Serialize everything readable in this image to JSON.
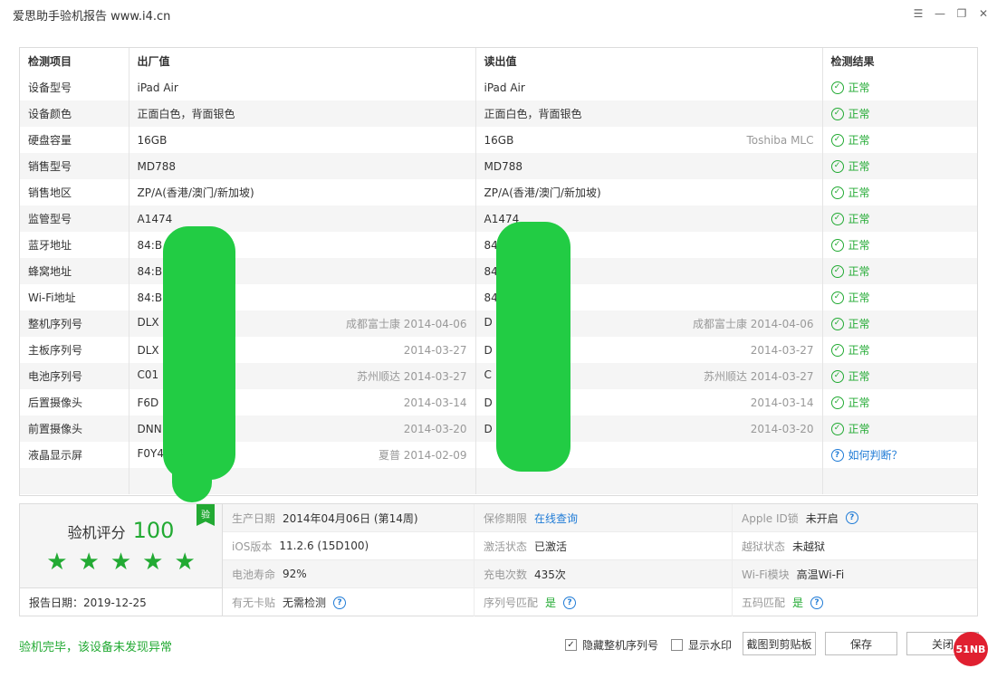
{
  "window": {
    "title": "爱思助手验机报告 www.i4.cn"
  },
  "table": {
    "headers": [
      "检测项目",
      "出厂值",
      "读出值",
      "检测结果"
    ],
    "rows": [
      {
        "item": "设备型号",
        "factory": "iPad Air",
        "factory_note": "",
        "read": "iPad Air",
        "read_note": "",
        "result": "正常",
        "result_kind": "ok"
      },
      {
        "item": "设备颜色",
        "factory": "正面白色，背面银色",
        "factory_note": "",
        "read": "正面白色，背面银色",
        "read_note": "",
        "result": "正常",
        "result_kind": "ok"
      },
      {
        "item": "硬盘容量",
        "factory": "16GB",
        "factory_note": "",
        "read": "16GB",
        "read_note": "Toshiba MLC",
        "result": "正常",
        "result_kind": "ok"
      },
      {
        "item": "销售型号",
        "factory": "MD788",
        "factory_note": "",
        "read": "MD788",
        "read_note": "",
        "result": "正常",
        "result_kind": "ok"
      },
      {
        "item": "销售地区",
        "factory": "ZP/A(香港/澳门/新加坡)",
        "factory_note": "",
        "read": "ZP/A(香港/澳门/新加坡)",
        "read_note": "",
        "result": "正常",
        "result_kind": "ok"
      },
      {
        "item": "监管型号",
        "factory": "A1474",
        "factory_note": "",
        "read": "A1474",
        "read_note": "",
        "result": "正常",
        "result_kind": "ok"
      },
      {
        "item": "蓝牙地址",
        "factory": "84:B",
        "factory_note": "",
        "read": "84:",
        "read_note": "",
        "result": "正常",
        "result_kind": "ok"
      },
      {
        "item": "蜂窝地址",
        "factory": "84:B",
        "factory_note": "",
        "read": "84:",
        "read_note": "",
        "result": "正常",
        "result_kind": "ok"
      },
      {
        "item": "Wi-Fi地址",
        "factory": "84:B",
        "factory_note": "",
        "read": "84",
        "read_note": "",
        "result": "正常",
        "result_kind": "ok"
      },
      {
        "item": "整机序列号",
        "factory": "DLX",
        "factory_note": "成都富士康 2014-04-06",
        "read": "D",
        "read_note": "成都富士康 2014-04-06",
        "result": "正常",
        "result_kind": "ok"
      },
      {
        "item": "主板序列号",
        "factory": "DLX",
        "factory_note": "2014-03-27",
        "read": "D",
        "read_note": "2014-03-27",
        "result": "正常",
        "result_kind": "ok"
      },
      {
        "item": "电池序列号",
        "factory": "C01",
        "factory_note": "苏州顺达 2014-03-27",
        "read": "C",
        "read_note": "苏州顺达 2014-03-27",
        "result": "正常",
        "result_kind": "ok"
      },
      {
        "item": "后置摄像头",
        "factory": "F6D",
        "factory_note": "2014-03-14",
        "read": "D",
        "read_note": "2014-03-14",
        "result": "正常",
        "result_kind": "ok"
      },
      {
        "item": "前置摄像头",
        "factory": "DNN",
        "factory_note": "2014-03-20",
        "read": "D",
        "read_note": "2014-03-20",
        "result": "正常",
        "result_kind": "ok"
      },
      {
        "item": "液晶显示屏",
        "factory": "F0Y4",
        "factory_note": "夏普 2014-02-09",
        "read": "",
        "read_note": "",
        "result": "如何判断？",
        "result_kind": "help"
      }
    ]
  },
  "score": {
    "label": "验机评分",
    "value": "100",
    "badge": "验",
    "stars": 5,
    "report_date": "报告日期：2019-12-25"
  },
  "info": [
    {
      "key": "生产日期",
      "value": "2014年04月06日 (第14周)",
      "kind": "text"
    },
    {
      "key": "保修期限",
      "value": "在线查询",
      "kind": "link"
    },
    {
      "key": "Apple ID锁",
      "value": "未开启",
      "kind": "text",
      "help": true
    },
    {
      "key": "iOS版本",
      "value": "11.2.6 (15D100)",
      "kind": "text"
    },
    {
      "key": "激活状态",
      "value": "已激活",
      "kind": "text"
    },
    {
      "key": "越狱状态",
      "value": "未越狱",
      "kind": "text"
    },
    {
      "key": "电池寿命",
      "value": "92%",
      "kind": "text"
    },
    {
      "key": "充电次数",
      "value": "435次",
      "kind": "text"
    },
    {
      "key": "Wi-Fi模块",
      "value": "高温Wi-Fi",
      "kind": "text"
    },
    {
      "key": "有无卡贴",
      "value": "无需检测",
      "kind": "text",
      "help": true
    },
    {
      "key": "序列号匹配",
      "value": "是",
      "kind": "green",
      "help": true
    },
    {
      "key": "五码匹配",
      "value": "是",
      "kind": "green",
      "help": true
    }
  ],
  "footer": {
    "status": "验机完毕，该设备未发现异常",
    "hide_serial": "隐藏整机序列号",
    "show_watermark": "显示水印",
    "copy_btn": "截图到剪贴板",
    "save_btn": "保存",
    "close_btn": "关闭",
    "brand": "51NB"
  },
  "colors": {
    "accent": "#22aa33",
    "link": "#1f7bd6"
  }
}
